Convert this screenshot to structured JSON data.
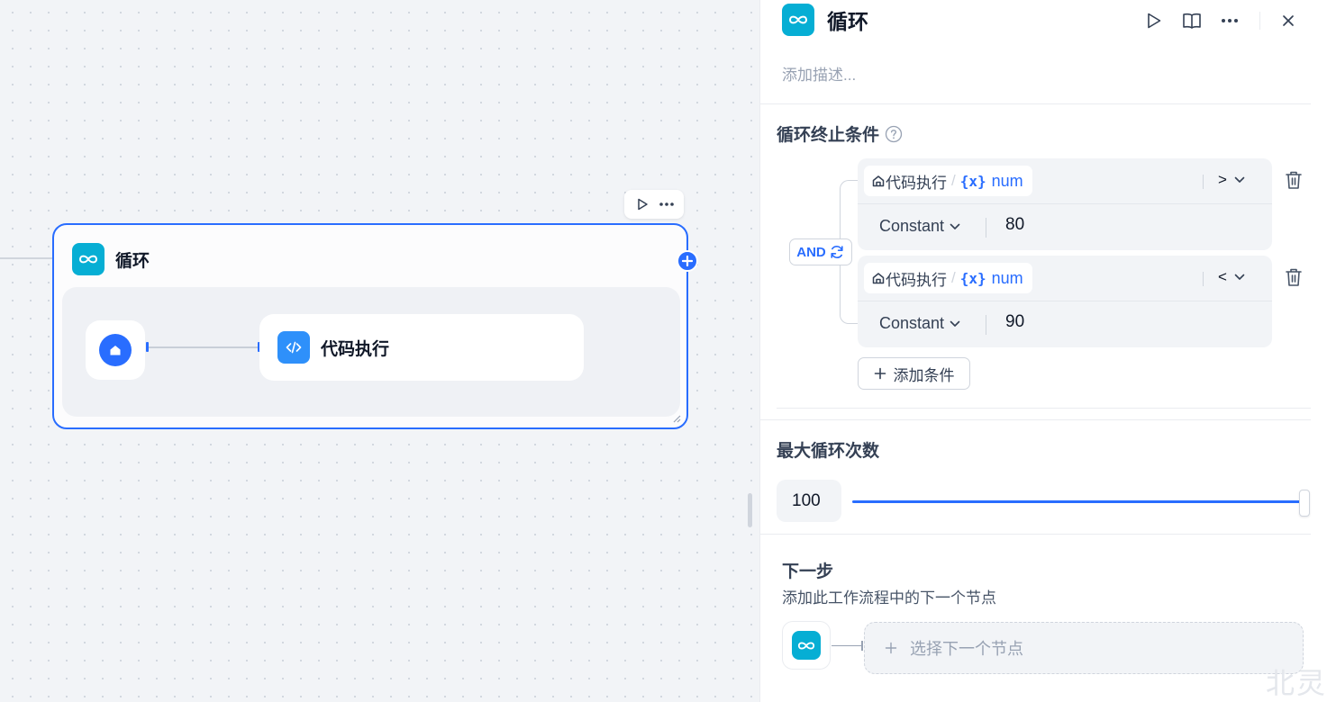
{
  "canvas": {
    "loop_node": {
      "title": "循环",
      "child_node": {
        "title": "代码执行"
      }
    }
  },
  "panel": {
    "title": "循环",
    "description_placeholder": "添加描述...",
    "conditions": {
      "title": "循环终止条件",
      "logic_operator": "AND",
      "items": [
        {
          "node": "代码执行",
          "var_type_icon": "{x}",
          "variable": "num",
          "operator": ">",
          "value_type": "Constant",
          "value": "80"
        },
        {
          "node": "代码执行",
          "var_type_icon": "{x}",
          "variable": "num",
          "operator": "<",
          "value_type": "Constant",
          "value": "90"
        }
      ],
      "add_label": "添加条件"
    },
    "max_loop": {
      "title": "最大循环次数",
      "value": "100",
      "slider_fraction": 1.0
    },
    "next_step": {
      "title": "下一步",
      "subtitle": "添加此工作流程中的下一个节点",
      "select_placeholder": "选择下一个节点"
    }
  },
  "watermark": "北灵",
  "colors": {
    "accent": "#296dff",
    "loop_icon": "#06aed4",
    "code_icon": "#2e90fa"
  },
  "icons": [
    "loop-icon",
    "play-icon",
    "book-icon",
    "more-icon",
    "close-icon",
    "help-icon",
    "home-icon",
    "code-icon",
    "swap-icon",
    "trash-icon",
    "chevron-down-icon",
    "plus-icon"
  ]
}
